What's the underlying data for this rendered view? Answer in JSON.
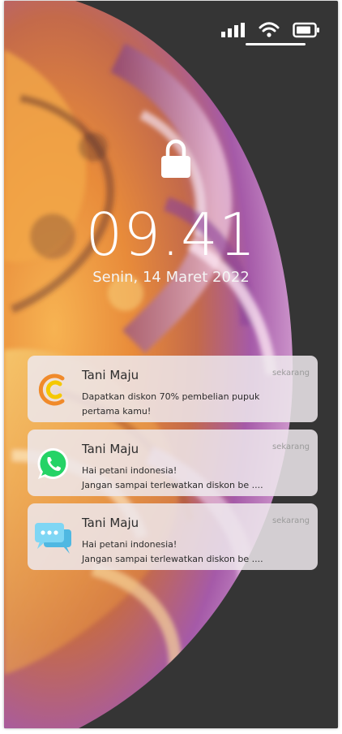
{
  "status_bar": {
    "icons": [
      "signal-bars-icon",
      "wifi-icon",
      "battery-icon"
    ]
  },
  "lock_screen": {
    "lock_icon": "lock-icon",
    "time": "09.41",
    "date": "Senin, 14 Maret 2022"
  },
  "notifications": [
    {
      "icon": "tani-maju-logo-icon",
      "app": "Tani Maju",
      "time": "sekarang",
      "line1": "Dapatkan diskon 70% pembelian pupuk",
      "line2": "pertama kamu!"
    },
    {
      "icon": "whatsapp-icon",
      "app": "Tani Maju",
      "time": "sekarang",
      "line1": "Hai petani indonesia!",
      "line2": "Jangan sampai terlewatkan diskon be ...."
    },
    {
      "icon": "message-bubbles-icon",
      "app": "Tani Maju",
      "time": "sekarang",
      "line1": "Hai petani indonesia!",
      "line2": "Jangan sampai terlewatkan diskon be ...."
    }
  ],
  "colors": {
    "background": "#353535",
    "notification_bg": "#eee8ec",
    "brand_orange": "#f08a2a",
    "brand_yellow": "#f5c800",
    "whatsapp_green": "#25d366",
    "messages_blue": "#5ec8ee"
  }
}
